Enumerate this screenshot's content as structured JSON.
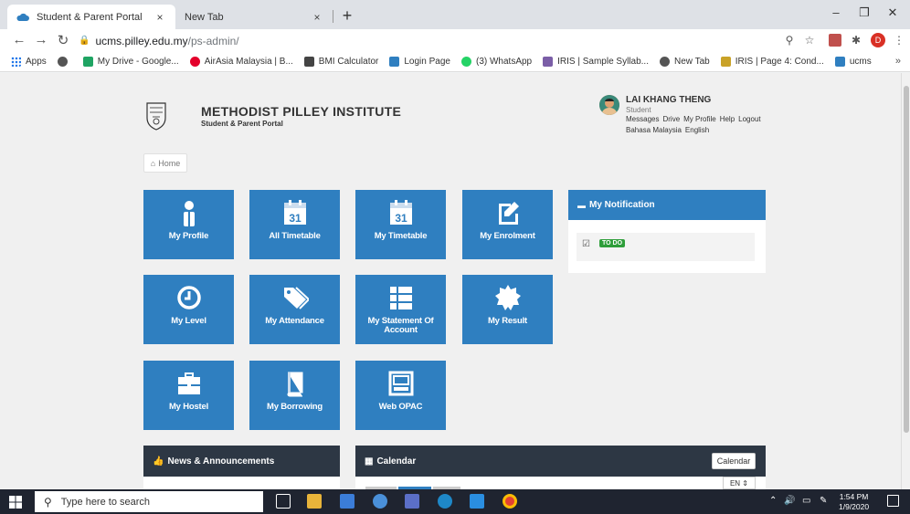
{
  "browser": {
    "tabs": [
      {
        "title": "Student & Parent Portal",
        "close": "×"
      },
      {
        "title": "New Tab",
        "close": "×"
      }
    ],
    "new_tab": "+",
    "window_controls": {
      "minimize": "–",
      "restore": "❐",
      "close": "✕"
    },
    "url": {
      "host": "ucms.pilley.edu.my",
      "path": "/ps-admin/"
    },
    "profile_initial": "D",
    "bookmarks": [
      {
        "label": "Apps",
        "color": "#1a73e8"
      },
      {
        "label": "",
        "color": "#555555"
      },
      {
        "label": "My Drive - Google...",
        "color": "#1fa463"
      },
      {
        "label": "AirAsia Malaysia | B...",
        "color": "#e4002b"
      },
      {
        "label": "BMI Calculator",
        "color": "#444444"
      },
      {
        "label": "Login Page",
        "color": "#2f7fc0"
      },
      {
        "label": "(3) WhatsApp",
        "color": "#25d366"
      },
      {
        "label": "IRIS | Sample Syllab...",
        "color": "#7b5ea7"
      },
      {
        "label": "New Tab",
        "color": "#555555"
      },
      {
        "label": "IRIS | Page 4: Cond...",
        "color": "#c9a227"
      },
      {
        "label": "ucms",
        "color": "#2f7fc0"
      }
    ],
    "bookmarks_more": "»"
  },
  "header": {
    "institute_name": "METHODIST PILLEY INSTITUTE",
    "subtitle": "Student & Parent Portal",
    "user": {
      "name": "LAI KHANG THENG",
      "role": "Student",
      "links": [
        "Messages",
        "Drive",
        "My Profile",
        "Help",
        "Logout"
      ],
      "languages": [
        "Bahasa Malaysia",
        "English"
      ]
    }
  },
  "breadcrumb": {
    "home": "Home"
  },
  "tiles": [
    {
      "label": "My Profile",
      "icon": "person-icon"
    },
    {
      "label": "All Timetable",
      "icon": "calendar-icon",
      "day": "31"
    },
    {
      "label": "My Timetable",
      "icon": "calendar-icon",
      "day": "31"
    },
    {
      "label": "My Enrolment",
      "icon": "edit-icon"
    },
    {
      "label": "My Level",
      "icon": "clock-icon"
    },
    {
      "label": "My Attendance",
      "icon": "tag-icon"
    },
    {
      "label": "My Statement Of Account",
      "icon": "list-icon"
    },
    {
      "label": "My Result",
      "icon": "certificate-icon"
    },
    {
      "label": "My Hostel",
      "icon": "briefcase-icon"
    },
    {
      "label": "My Borrowing",
      "icon": "book-icon"
    },
    {
      "label": "Web OPAC",
      "icon": "terminal-icon"
    }
  ],
  "notification": {
    "title": "My Notification",
    "badge": "TO DO"
  },
  "news": {
    "title": "News & Announcements"
  },
  "calendar": {
    "title": "Calendar",
    "button": "Calendar",
    "language": "EN ⇕"
  },
  "taskbar": {
    "search_placeholder": "Type here to search",
    "time": "1:54 PM",
    "date": "1/9/2020",
    "colors": {
      "bg": "#1f2430"
    }
  },
  "colors": {
    "tile": "#2f7fc0",
    "dark_panel": "#2d3744",
    "todo": "#2e9e3a"
  }
}
